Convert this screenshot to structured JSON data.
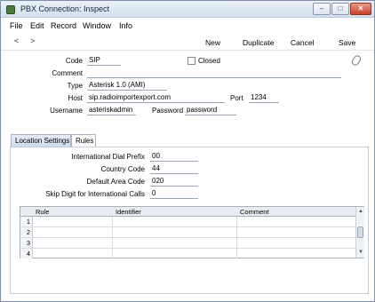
{
  "window": {
    "title": "PBX Connection: Inspect"
  },
  "title_buttons": {
    "minimize": "–",
    "maximize": "□",
    "close": "✕"
  },
  "menu": [
    "File",
    "Edit",
    "Record",
    "Window",
    "Info"
  ],
  "nav": {
    "prev": "<",
    "next": ">"
  },
  "toolbar": {
    "new": "New",
    "duplicate": "Duplicate",
    "cancel": "Cancel",
    "save": "Save"
  },
  "header": {
    "code_label": "Code",
    "code_value": "SIP",
    "closed_label": "Closed",
    "closed_checked": false,
    "comment_label": "Comment",
    "comment_value": "",
    "type_label": "Type",
    "type_value": "Asterisk 1.0 (AMI)",
    "host_label": "Host",
    "host_value": "sip.radioimportexport.com",
    "port_label": "Port",
    "port_value": "1234",
    "username_label": "Username",
    "username_value": "asteriskadmin",
    "password_label": "Password",
    "password_value": "password"
  },
  "tabs": [
    "Location Settings",
    "Rules"
  ],
  "location": {
    "intl_prefix_label": "International Dial Prefix",
    "intl_prefix_value": "00",
    "country_label": "Country Code",
    "country_value": "44",
    "area_label": "Default Area Code",
    "area_value": "020",
    "skip_label": "Skip Digit for International Calls",
    "skip_value": "0"
  },
  "grid": {
    "columns": [
      "Rule",
      "Identifier",
      "Comment"
    ],
    "rows": [
      {
        "num": "1",
        "rule": "",
        "identifier": "",
        "comment": ""
      },
      {
        "num": "2",
        "rule": "",
        "identifier": "",
        "comment": ""
      },
      {
        "num": "3",
        "rule": "",
        "identifier": "",
        "comment": ""
      },
      {
        "num": "4",
        "rule": "",
        "identifier": "",
        "comment": ""
      }
    ]
  },
  "icons": {
    "attachment": "paperclip-icon",
    "app": "app-icon"
  }
}
